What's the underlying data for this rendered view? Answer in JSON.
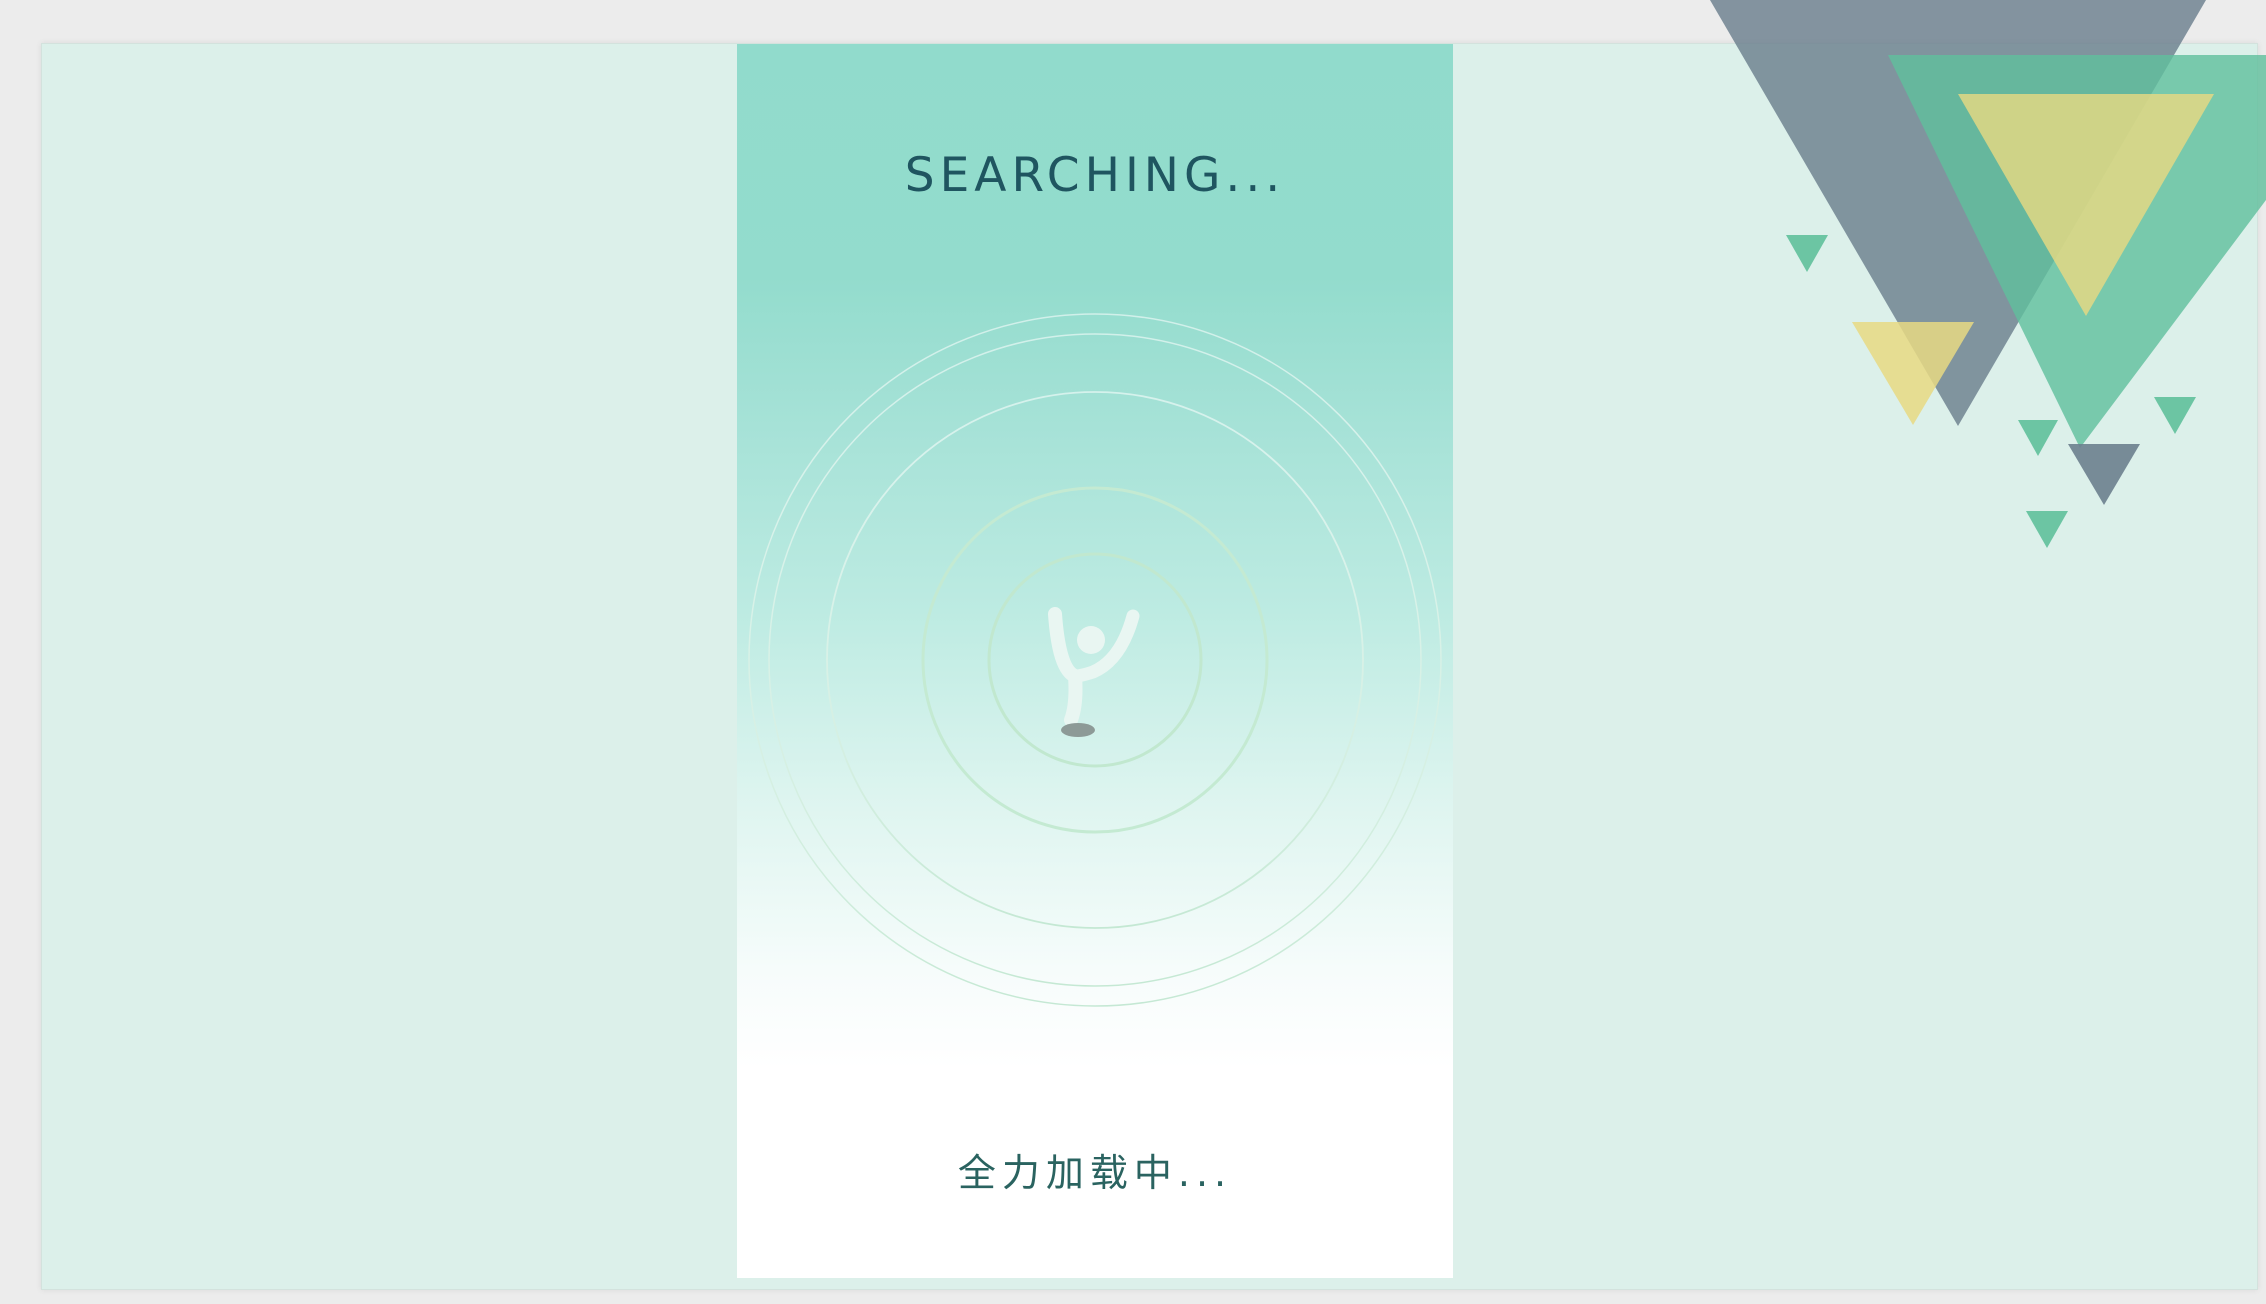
{
  "screen": {
    "title": "SEARCHING...",
    "loading_text": "全力加载中..."
  },
  "icons": {
    "center": "person-jumping-icon"
  },
  "colors": {
    "background": "#dcf0ea",
    "phone_top": "#91dbcc",
    "text": "#1f5560",
    "triangle_slate": "#6b7f8e",
    "triangle_green": "#5fbf9c",
    "triangle_yellow": "#e7d983"
  }
}
